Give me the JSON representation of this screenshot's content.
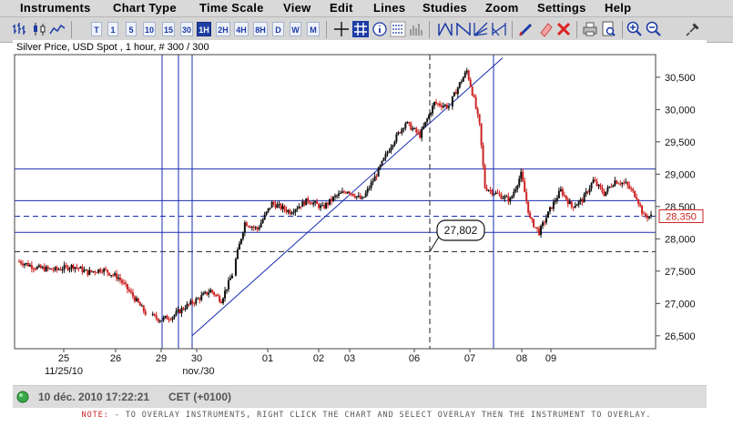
{
  "menu": [
    "Instruments",
    "Chart Type",
    "Time Scale",
    "View",
    "Edit",
    "Lines",
    "Studies",
    "Zoom",
    "Settings",
    "Help"
  ],
  "toolbar": {
    "timeframes": [
      "T",
      "1",
      "5",
      "10",
      "15",
      "30",
      "1H",
      "2H",
      "4H",
      "8H",
      "D",
      "W",
      "M"
    ],
    "active_timeframe": "1H",
    "chart_type_icons": [
      "bar-chart-icon",
      "candlestick-icon",
      "line-chart-icon"
    ],
    "tool_icons": [
      "crosshair-icon",
      "grid-icon",
      "info-icon",
      "horizontal-lines-icon",
      "volume-icon",
      "trendline-up-icon",
      "trendline-down-icon",
      "fan-icon",
      "channel-icon",
      "pencil-icon",
      "eraser-icon",
      "delete-icon",
      "print-icon",
      "print-preview-icon",
      "zoom-in-icon",
      "zoom-out-icon",
      "pin-icon"
    ]
  },
  "chart": {
    "title": "Silver Price, USD Spot , 1 hour, # 300 / 300",
    "crosshair_value": "27,802",
    "current_price": "28,350"
  },
  "status": {
    "datetime": "10 déc. 2010 17:22:21",
    "timezone": "CET (+0100)"
  },
  "note": {
    "label": "NOTE:",
    "text": "- TO OVERLAY INSTRUMENTS, RIGHT CLICK THE CHART AND SELECT OVERLAY THEN THE INSTRUMENT TO OVERLAY."
  },
  "colors": {
    "up": "#111111",
    "down": "#cc2222",
    "lines": "#1a2db0",
    "price_box": "#cc2222"
  },
  "chart_data": {
    "type": "candlestick",
    "title": "Silver Price, USD Spot , 1 hour, # 300 / 300",
    "ylim": [
      26300,
      30850
    ],
    "y_ticks": [
      26500,
      27000,
      27500,
      28000,
      28500,
      29000,
      29500,
      30000,
      30500
    ],
    "y_tick_labels": [
      "26,500",
      "27,000",
      "27,500",
      "28,000",
      "28,500",
      "29,000",
      "29,500",
      "30,000",
      "30,500"
    ],
    "x_tick_labels": [
      "25",
      "26",
      "29",
      "30",
      "01",
      "02",
      "03",
      "06",
      "07",
      "08",
      "09"
    ],
    "x_sublabels": [
      "11/25/10",
      "nov./30"
    ],
    "horizontal_lines": [
      29080,
      28590,
      28100
    ],
    "dashed_horizontal_lines": [
      28350,
      27802
    ],
    "approx_close_anchors": [
      [
        0,
        27650
      ],
      [
        10,
        27550
      ],
      [
        20,
        27520
      ],
      [
        30,
        27580
      ],
      [
        38,
        27480
      ],
      [
        46,
        27530
      ],
      [
        55,
        27400
      ],
      [
        62,
        27150
      ],
      [
        70,
        26850
      ],
      [
        78,
        26750
      ],
      [
        85,
        26800
      ],
      [
        92,
        26950
      ],
      [
        98,
        27050
      ],
      [
        106,
        27200
      ],
      [
        112,
        27050
      ],
      [
        118,
        27450
      ],
      [
        125,
        28250
      ],
      [
        132,
        28150
      ],
      [
        140,
        28550
      ],
      [
        150,
        28420
      ],
      [
        160,
        28600
      ],
      [
        168,
        28480
      ],
      [
        175,
        28650
      ],
      [
        182,
        28750
      ],
      [
        190,
        28600
      ],
      [
        198,
        29000
      ],
      [
        206,
        29450
      ],
      [
        214,
        29800
      ],
      [
        222,
        29600
      ],
      [
        230,
        30100
      ],
      [
        238,
        30050
      ],
      [
        244,
        30400
      ],
      [
        248,
        30600
      ],
      [
        252,
        30150
      ],
      [
        255,
        29750
      ],
      [
        258,
        28800
      ],
      [
        264,
        28700
      ],
      [
        272,
        28600
      ],
      [
        278,
        29000
      ],
      [
        283,
        28300
      ],
      [
        288,
        28100
      ],
      [
        294,
        28450
      ],
      [
        300,
        28750
      ],
      [
        306,
        28500
      ],
      [
        312,
        28600
      ],
      [
        318,
        28900
      ],
      [
        324,
        28700
      ],
      [
        330,
        28900
      ],
      [
        336,
        28850
      ],
      [
        342,
        28650
      ],
      [
        346,
        28350
      ]
    ]
  }
}
